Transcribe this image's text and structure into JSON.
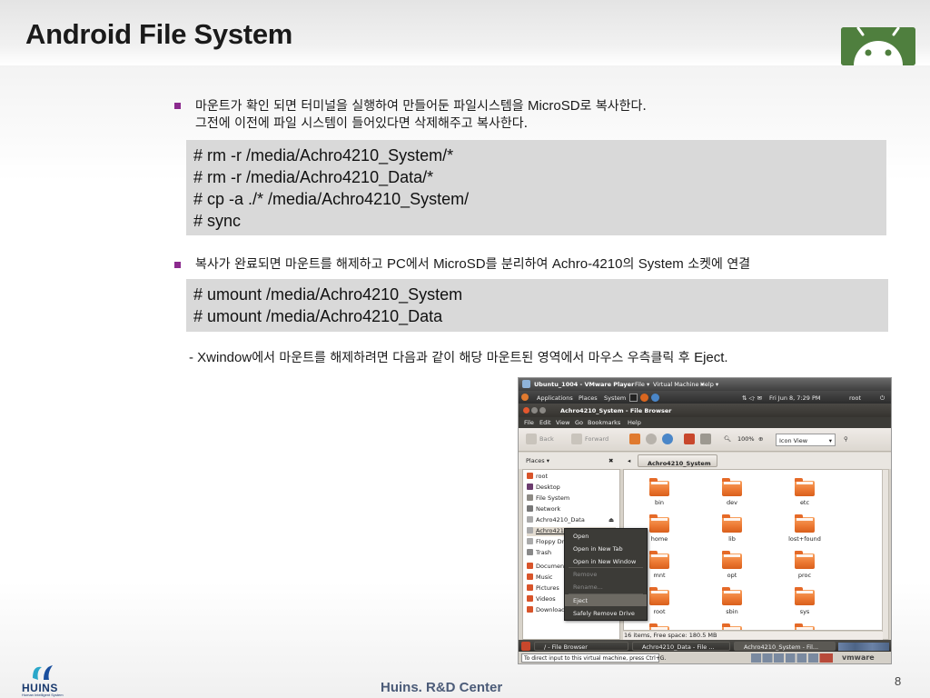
{
  "slide": {
    "title": "Android File System",
    "bullet1_line1_a": "마운트가 확인 되면 터미널을 실행하여 만들어둔 파일시스템을 ",
    "bullet1_line1_b": "MicroSD",
    "bullet1_line1_c": "로 복사한다.",
    "bullet1_line2": "그전에 이전에 파일 시스템이 들어있다면 삭제해주고 복사한다.",
    "code1": [
      "# rm  -r  /media/Achro4210_System/*",
      "# rm  -r  /media/Achro4210_Data/*",
      "# cp  -a  ./*  /media/Achro4210_System/",
      "# sync"
    ],
    "bullet2_a": "복사가 완료되면 마운트를 해제하고 ",
    "bullet2_b": "PC",
    "bullet2_c": "에서 ",
    "bullet2_d": "MicroSD",
    "bullet2_e": "를 분리하여 ",
    "bullet2_f": "Achro-4210",
    "bullet2_g": "의 ",
    "bullet2_h": "System",
    "bullet2_i": " 소켓에 연결",
    "code2": [
      "# umount  /media/Achro4210_System",
      "# umount  /media/Achro4210_Data"
    ],
    "note_a": "- Xwindow",
    "note_b": "에서 마운트를 해제하려면 다음과 같이 해당 마운트된 영역에서 마우스 우측클릭 후 ",
    "note_c": "Eject."
  },
  "screenshot": {
    "vm_title": "Ubuntu_1004 - VMware Player",
    "vm_menus": [
      "File ▾",
      "Virtual Machine ▾",
      "Help ▾"
    ],
    "panel_menus": [
      "Applications",
      "Places",
      "System"
    ],
    "panel_clock": "Fri Jun  8,  7:29 PM",
    "panel_user": "root",
    "fb_title": "Achro4210_System - File Browser",
    "fb_menus": [
      "File",
      "Edit",
      "View",
      "Go",
      "Bookmarks",
      "Help"
    ],
    "toolbar": {
      "back": "Back",
      "forward": "Forward",
      "zoom": "100%",
      "view_mode": "Icon View"
    },
    "places_label": "Places ▾",
    "path_button": "Achro4210_System",
    "sidebar": [
      "root",
      "Desktop",
      "File System",
      "Network",
      "Achro4210_Data",
      "Achro4210_System",
      "Floppy Dri",
      "Trash",
      "Documen",
      "Music",
      "Pictures",
      "Videos",
      "Download"
    ],
    "folders": [
      "bin",
      "dev",
      "etc",
      "home",
      "lib",
      "lost+found",
      "mnt",
      "opt",
      "proc",
      "root",
      "sbin",
      "sys"
    ],
    "status": "16 items, Free space: 180.5 MB",
    "context_menu": [
      "Open",
      "Open in New Tab",
      "Open in New Window",
      "Remove",
      "Rename...",
      "Eject",
      "Safely Remove Drive"
    ],
    "taskbar": [
      "/ - File Browser",
      "Achro4210_Data - File ...",
      "Achro4210_System - Fil..."
    ],
    "hint": "To direct input to this virtual machine, press Ctrl+G.",
    "vmware_logo": "vmware"
  },
  "footer": {
    "brand": "HUINS",
    "brand_sub": "Human Intelligent System",
    "center": "Huins. R&D Center",
    "page": "8"
  },
  "colors": {
    "bullet": "#8b2a8e",
    "code_bg": "#d9d9d9",
    "android_green": "#5a8b47",
    "folder_orange": "#ed7a34"
  }
}
